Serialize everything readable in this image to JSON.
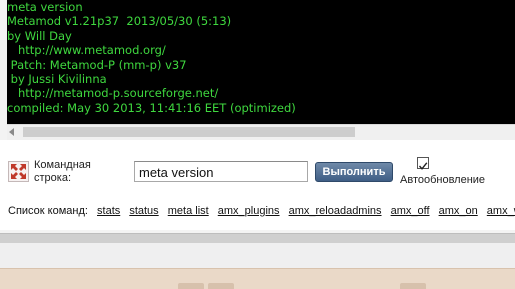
{
  "console": {
    "lines": [
      "meta version",
      "Metamod v1.21p37  2013/05/30 (5:13)",
      "by Will Day",
      "   http://www.metamod.org/",
      " Patch: Metamod-P (mm-p) v37",
      " by Jussi Kivilinna",
      "   http://metamod-p.sourceforge.net/",
      "compiled: May 30 2013, 11:41:16 EET (optimized)"
    ]
  },
  "command": {
    "label_line1": "Командная",
    "label_line2": "строка:",
    "input_value": "meta version",
    "run_button": "Выполнить",
    "auto_update_label": "Автообновление",
    "auto_update_checked": true
  },
  "command_list": {
    "label": "Список команд:",
    "items": [
      "stats",
      "status",
      "meta list",
      "amx_plugins",
      "amx_reloadadmins",
      "amx_off",
      "amx_on",
      "amx_who"
    ]
  },
  "colors": {
    "console_bg": "#000000",
    "console_text": "#3fd83f",
    "button_bg": "#4a6990"
  },
  "icons": {
    "command_icon": "expand-arrows-icon",
    "scroll_left": "scroll-left-arrow-icon",
    "checkbox": "checkmark-icon"
  }
}
